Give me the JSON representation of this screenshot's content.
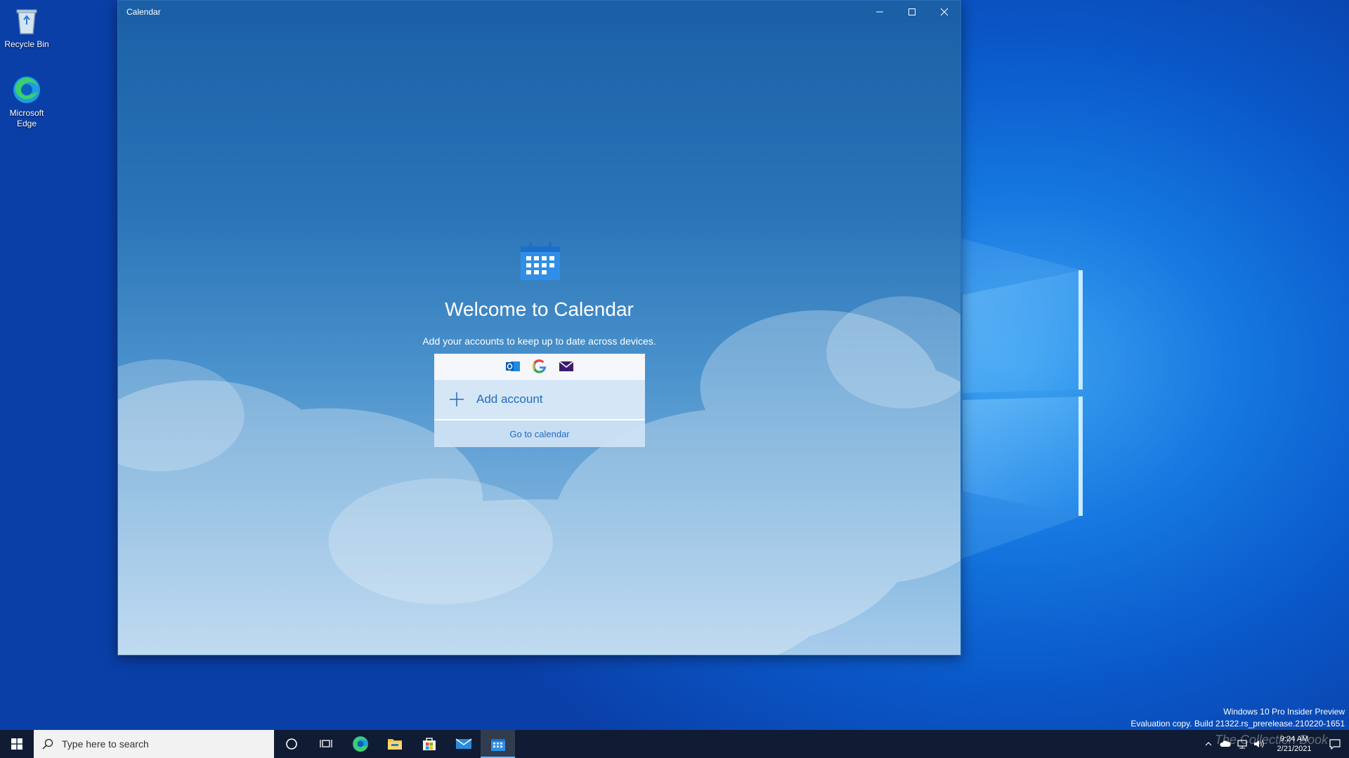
{
  "desktop": {
    "icons": [
      {
        "label": "Recycle Bin"
      },
      {
        "label": "Microsoft Edge"
      }
    ]
  },
  "window": {
    "title": "Calendar",
    "controls": [
      "minimize-icon",
      "maximize-icon",
      "close-icon"
    ]
  },
  "welcome": {
    "title": "Welcome to Calendar",
    "subtitle": "Add your accounts to keep up to date across devices.",
    "provider_icons": [
      "outlook-icon",
      "google-icon",
      "mail-icon"
    ],
    "add_account_label": "Add account",
    "go_to_calendar_label": "Go to calendar"
  },
  "watermark": {
    "line1": "Windows 10 Pro Insider Preview",
    "line2": "Evaluation copy. Build 21322.rs_prerelease.210220-1651"
  },
  "taskbar": {
    "search_placeholder": "Type here to search",
    "apps": [
      "cortana-icon",
      "task-view-icon",
      "edge-icon",
      "file-explorer-icon",
      "store-icon",
      "mail-icon",
      "calendar-icon"
    ],
    "active_app": "calendar-icon",
    "clock_time": "9:24 AM",
    "clock_date": "2/21/2021",
    "overlay_text": "The Collection Book"
  },
  "colors": {
    "accent": "#1f6cc4",
    "titlebar": "#1b5fa6",
    "taskbar": "#101c33"
  }
}
